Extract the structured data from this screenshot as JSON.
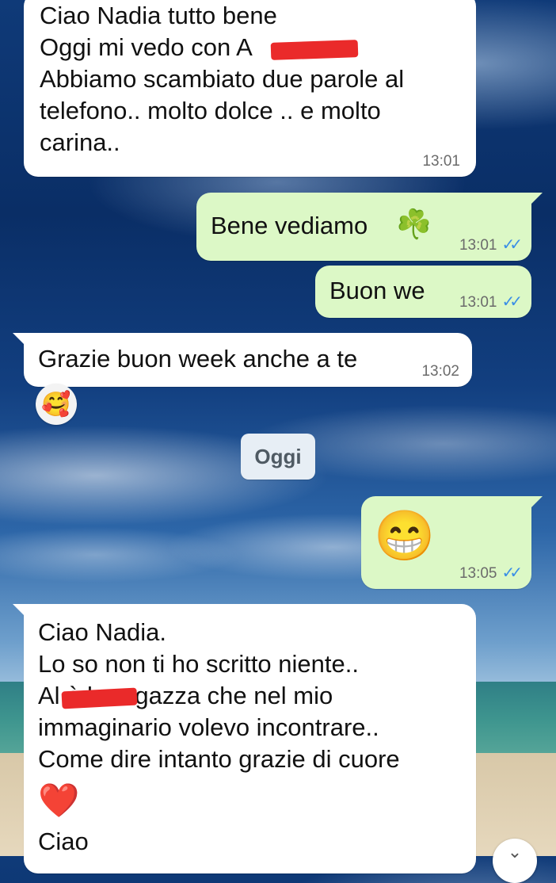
{
  "messages": [
    {
      "text": "Ciao Nadia tutto bene\nOggi mi vedo con A\nAbbiamo scambiato due parole al\ntelefono.. molto dolce .. e molto\ncarina..",
      "time": "13:01"
    },
    {
      "text": "Bene vediamo",
      "time": "13:01",
      "emoji": "☘️"
    },
    {
      "text": "Buon we",
      "time": "13:01"
    },
    {
      "text": "Grazie buon week anche a te",
      "time": "13:02",
      "reaction": "🥰"
    },
    {
      "emoji": "😁",
      "time": "13:05"
    },
    {
      "text": "Ciao Nadia.\nLo so non ti ho scritto niente..\nAl          è la ragazza che nel mio\nimmaginario volevo incontrare..\nCome dire intanto grazie di cuore",
      "heart": "❤️",
      "text2": "Ciao"
    }
  ],
  "date_divider": "Oggi",
  "ticks": "✓✓",
  "colors": {
    "incoming": "#ffffff",
    "outgoing": "#dcf8c6",
    "read_ticks": "#3a8ee6",
    "redaction": "#ea2a2a"
  },
  "scroll_button_icon": "chevron-down-icon"
}
